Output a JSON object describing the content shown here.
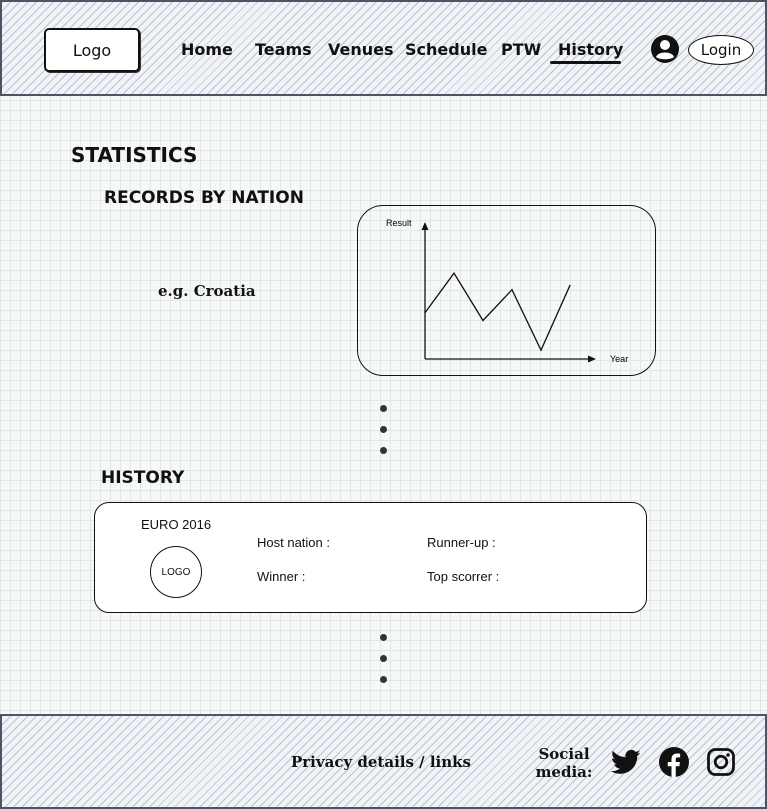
{
  "header": {
    "logo": "Logo",
    "nav": [
      "Home",
      "Teams",
      "Venues",
      "Schedule",
      "PTW",
      "History"
    ],
    "active_nav": "History",
    "login": "Login"
  },
  "main": {
    "statistics_title": "STATISTICS",
    "records_title": "RECORDS BY NATION",
    "example_nation": "e.g. Croatia",
    "chart": {
      "y_axis_label": "Result",
      "x_axis_label": "Year"
    },
    "history_title": "HISTORY",
    "history_card": {
      "title": "EURO 2016",
      "logo": "LOGO",
      "host_nation": "Host nation :",
      "runner_up": "Runner-up :",
      "winner": "Winner :",
      "top_scorer": "Top scorrer :"
    }
  },
  "chart_data": {
    "type": "line",
    "ylabel": "Result",
    "xlabel": "Year",
    "series": [
      {
        "values": [
          0.42,
          0.78,
          0.35,
          0.63,
          0.08,
          0.67
        ]
      }
    ]
  },
  "footer": {
    "privacy": "Privacy details / links",
    "social_line1": "Social",
    "social_line2": "media:",
    "social_icons": [
      "twitter-icon",
      "facebook-icon",
      "instagram-icon"
    ]
  },
  "colors": {
    "hatch": "#b9c3d1",
    "border": "#4a5566",
    "ink": "#111111"
  }
}
